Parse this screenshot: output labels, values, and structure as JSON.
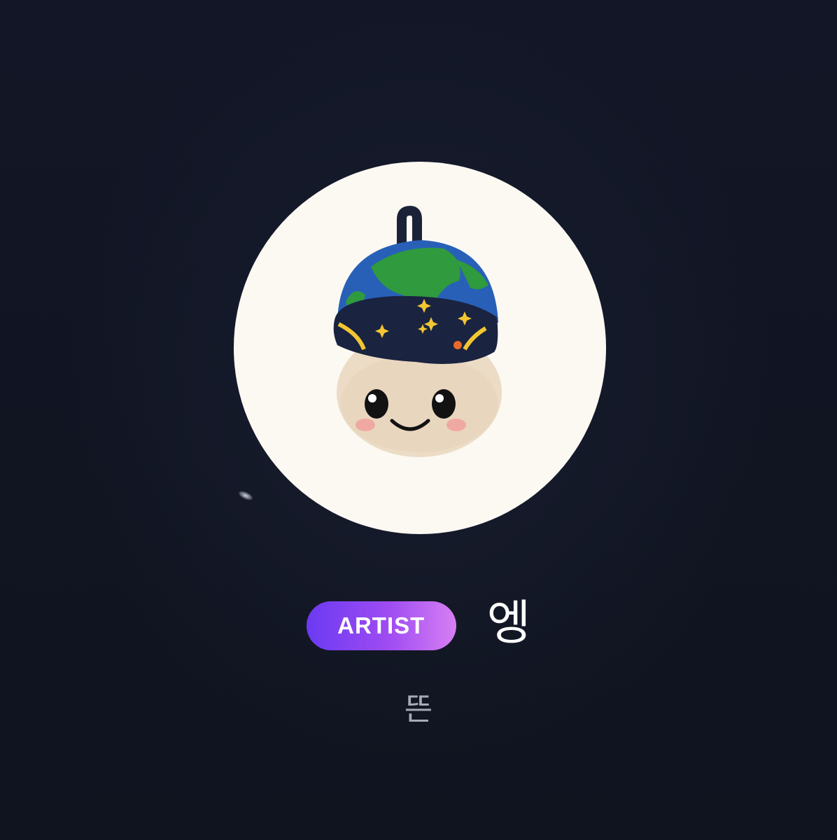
{
  "profile": {
    "badge_label": "ARTIST",
    "artist_name": "엥",
    "sub_name": "뜬"
  },
  "colors": {
    "background": "#111522",
    "avatar_background": "#fcf9f3",
    "badge_gradient_start": "#6b3af2",
    "badge_gradient_end": "#d77ff3",
    "name_text": "#ffffff",
    "sub_text": "#a7abb5"
  },
  "icons": {
    "avatar": "plush-doll-avatar"
  }
}
